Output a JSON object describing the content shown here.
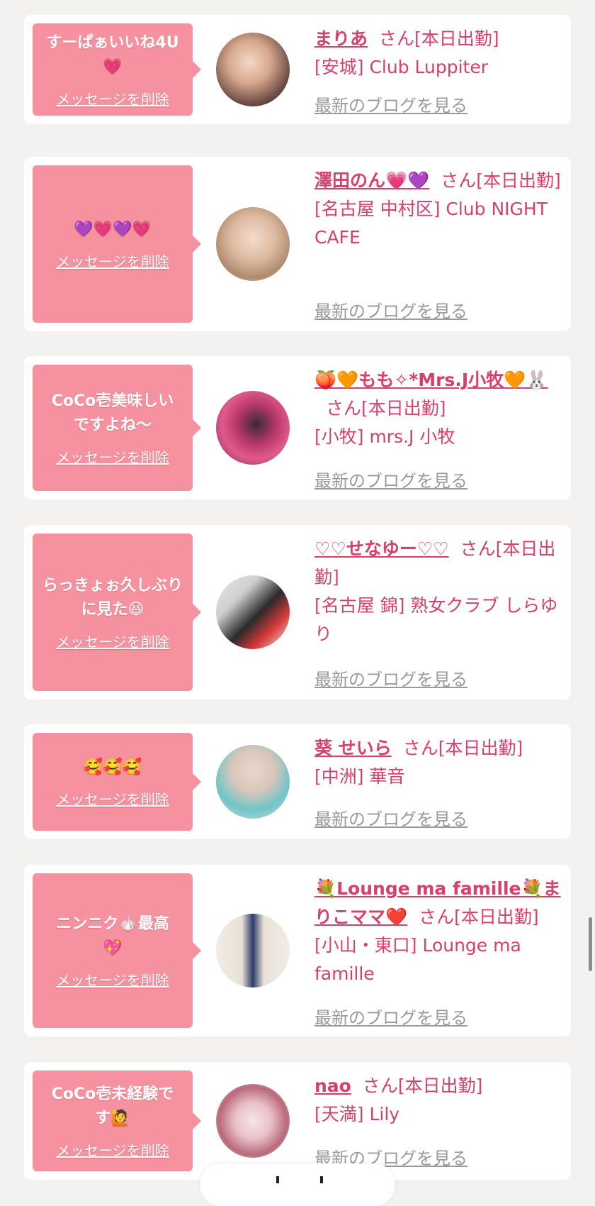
{
  "delete_label": "メッセージを削除",
  "blog_label": "最新のブログを見る",
  "san_suffix": "さん",
  "colors": {
    "bubble": "#f6929f",
    "name": "#d8406b",
    "link_gray": "#9a9a9a",
    "background": "#f3f2f1"
  },
  "cards": [
    {
      "message": "すーぱぁいいね4U\n💗",
      "name": "まりあ",
      "status": "[本日出勤]",
      "shop": "[安城] Club Luppiter"
    },
    {
      "message": "💜💗💜💗",
      "name": "澤田のん💗💜",
      "status": "[本日出勤]",
      "shop": "[名古屋 中村区] Club NIGHT CAFE"
    },
    {
      "message": "CoCo壱美味しい\nですよね〜",
      "name": "🍑🧡もも✧*Mrs.J小牧🧡🐰",
      "status": "[本日出勤]",
      "shop": "[小牧] mrs.J 小牧"
    },
    {
      "message": "らっきょぉ久しぶり\nに見た😆",
      "name": "♡♡せなゆー♡♡",
      "status": "[本日出勤]",
      "shop": "[名古屋 錦] 熟女クラブ しらゆり"
    },
    {
      "message": "🥰🥰🥰",
      "name": "葵 せいら",
      "status": "[本日出勤]",
      "shop": "[中洲] 華音"
    },
    {
      "message": "ニンニク🧄最高\n💖",
      "name": "💐Lounge ma famille💐まりこママ❤️",
      "status": "[本日出勤]",
      "shop": "[小山・東口] Lounge ma famille"
    },
    {
      "message": "CoCo壱未経験で\nす🙋",
      "name": "nao",
      "status": "[本日出勤]",
      "shop": "[天満] Lily"
    }
  ]
}
